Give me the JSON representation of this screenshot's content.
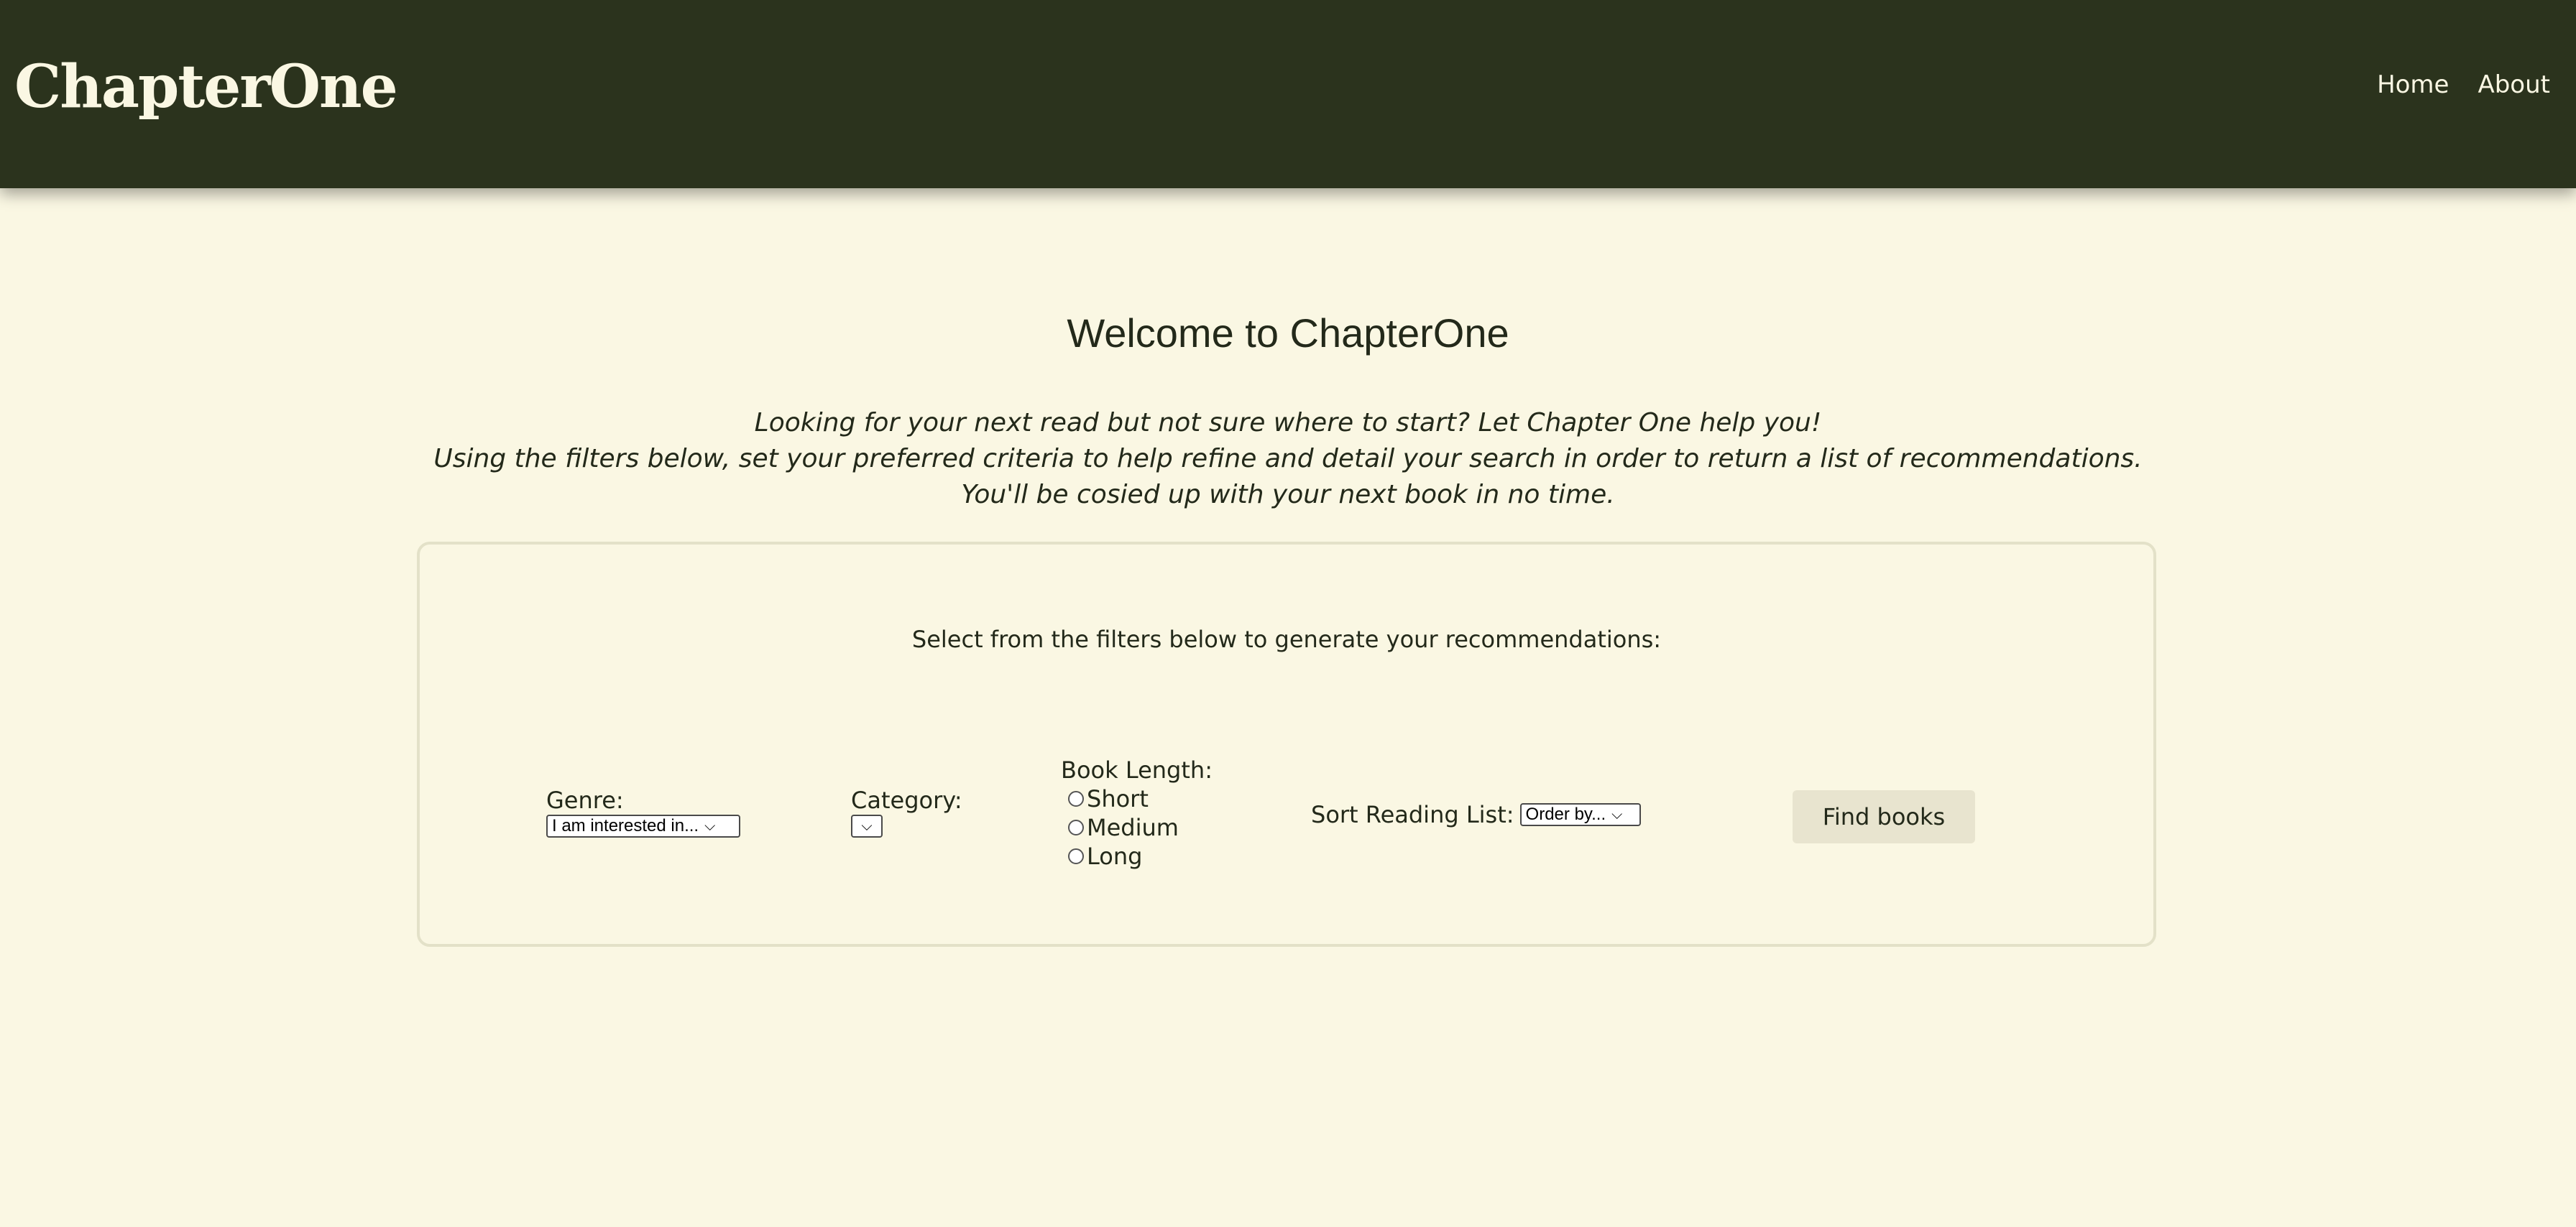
{
  "header": {
    "logo": "ChapterOne",
    "nav": {
      "home": "Home",
      "about": "About"
    }
  },
  "main": {
    "title": "Welcome to ChapterOne",
    "intro_lines": [
      "Looking for your next read but not sure where to start? Let Chapter One help you!",
      "Using the filters below, set your preferred criteria to help refine and detail your search in order to return a list of recommendations.",
      "You'll be cosied up with your next book in no time."
    ]
  },
  "filters": {
    "heading": "Select from the filters below to generate your recommendations:",
    "genre": {
      "label": "Genre:",
      "selected": "I am interested in..."
    },
    "category": {
      "label": "Category:",
      "selected": ""
    },
    "book_length": {
      "label": "Book Length:",
      "options": [
        "Short",
        "Medium",
        "Long"
      ]
    },
    "sort": {
      "label": "Sort Reading List:",
      "selected": "Order by..."
    },
    "submit_label": "Find books"
  },
  "icons": {
    "dropdown": "chevron-down-icon",
    "radio": "radio-unchecked-icon"
  },
  "colors": {
    "header_bg": "#2b331d",
    "page_bg": "#faf7e3",
    "text": "#23291a",
    "button_bg": "#e8e4cf"
  }
}
